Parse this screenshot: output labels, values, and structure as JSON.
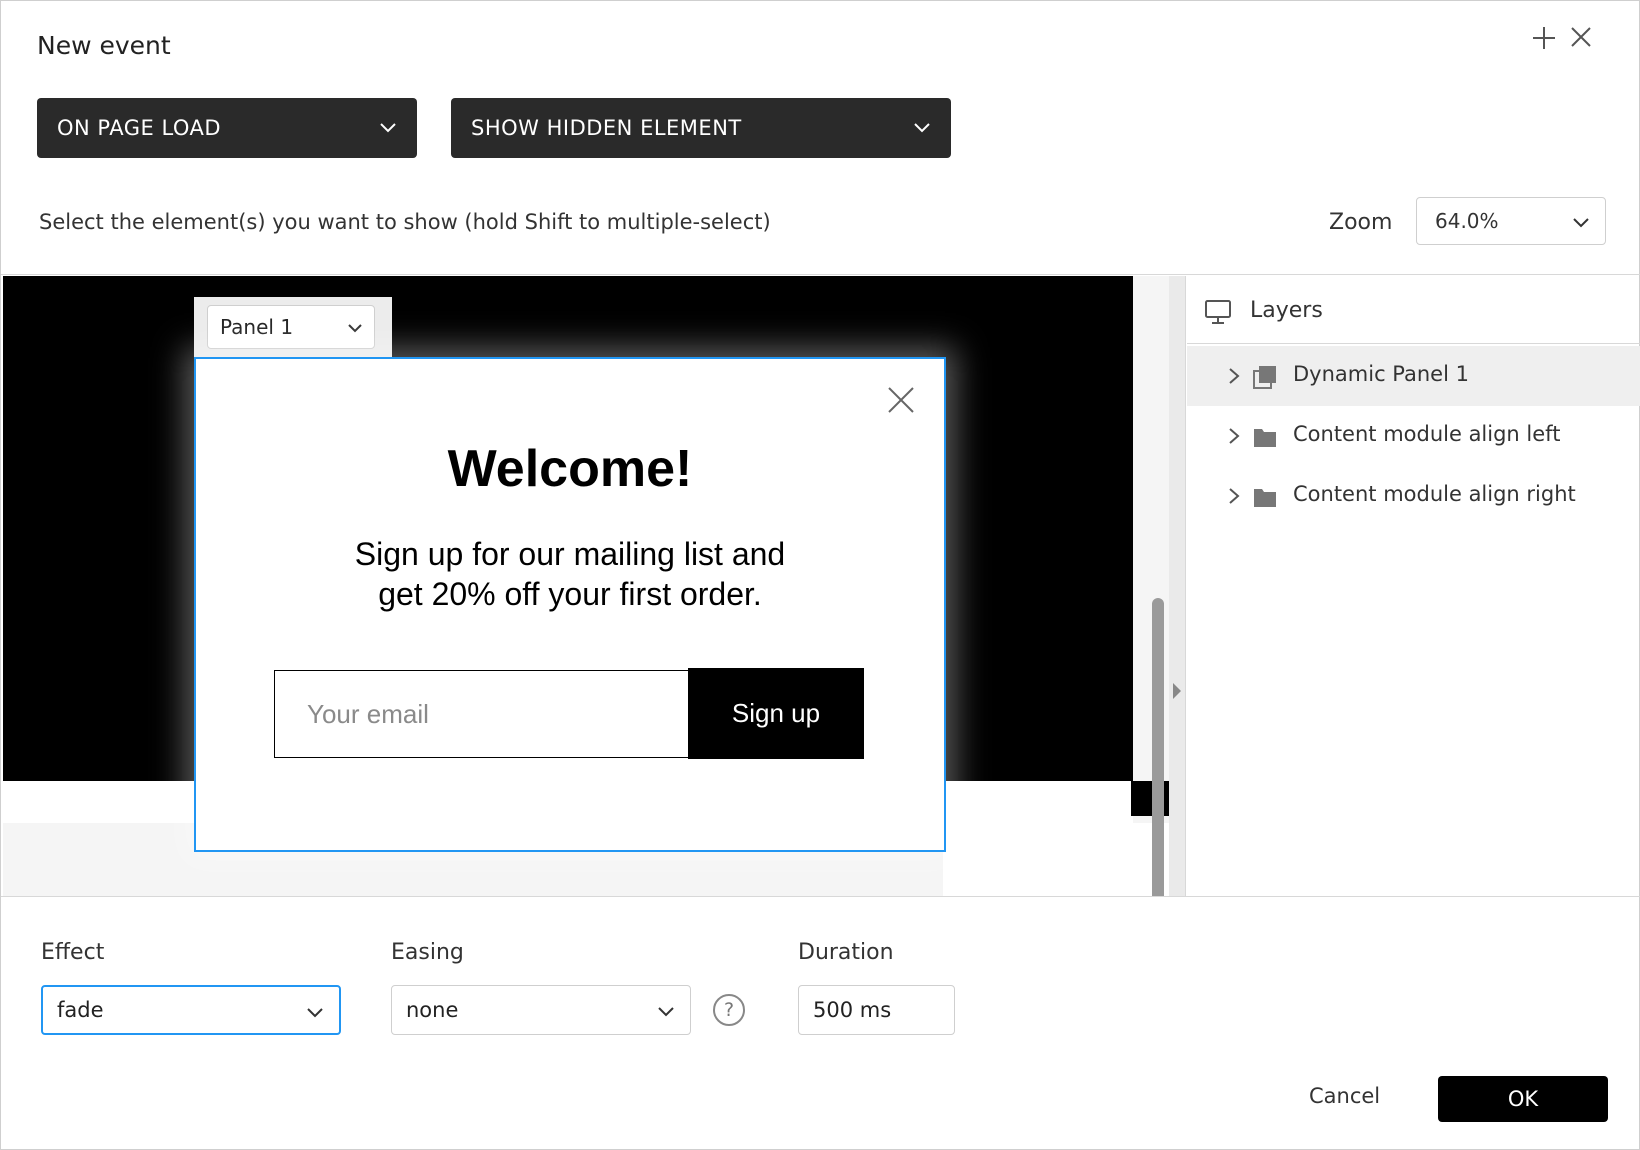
{
  "dialog": {
    "title": "New event"
  },
  "event": {
    "trigger_label": "ON PAGE LOAD",
    "action_label": "SHOW HIDDEN ELEMENT"
  },
  "instruction": "Select the element(s) you want to show (hold Shift to multiple-select)",
  "zoom": {
    "label": "Zoom",
    "value": "64.0%"
  },
  "canvas": {
    "panel_select": "Panel 1",
    "modal": {
      "heading": "Welcome!",
      "promo_line1": "Sign up for our mailing list and",
      "promo_line2": "get 20% off your first order.",
      "email_placeholder": "Your email",
      "signup_label": "Sign up"
    }
  },
  "layers": {
    "title": "Layers",
    "items": [
      {
        "label": "Dynamic Panel 1",
        "icon": "dynamic-panel-icon",
        "selected": true
      },
      {
        "label": "Content module align left",
        "icon": "folder-icon",
        "selected": false
      },
      {
        "label": "Content module align right",
        "icon": "folder-icon",
        "selected": false
      }
    ]
  },
  "settings": {
    "effect_label": "Effect",
    "effect_value": "fade",
    "easing_label": "Easing",
    "easing_value": "none",
    "duration_label": "Duration",
    "duration_value": "500 ms"
  },
  "footer": {
    "cancel_label": "Cancel",
    "ok_label": "OK"
  },
  "colors": {
    "accent": "#2196f3",
    "dark": "#2a2a2a"
  }
}
